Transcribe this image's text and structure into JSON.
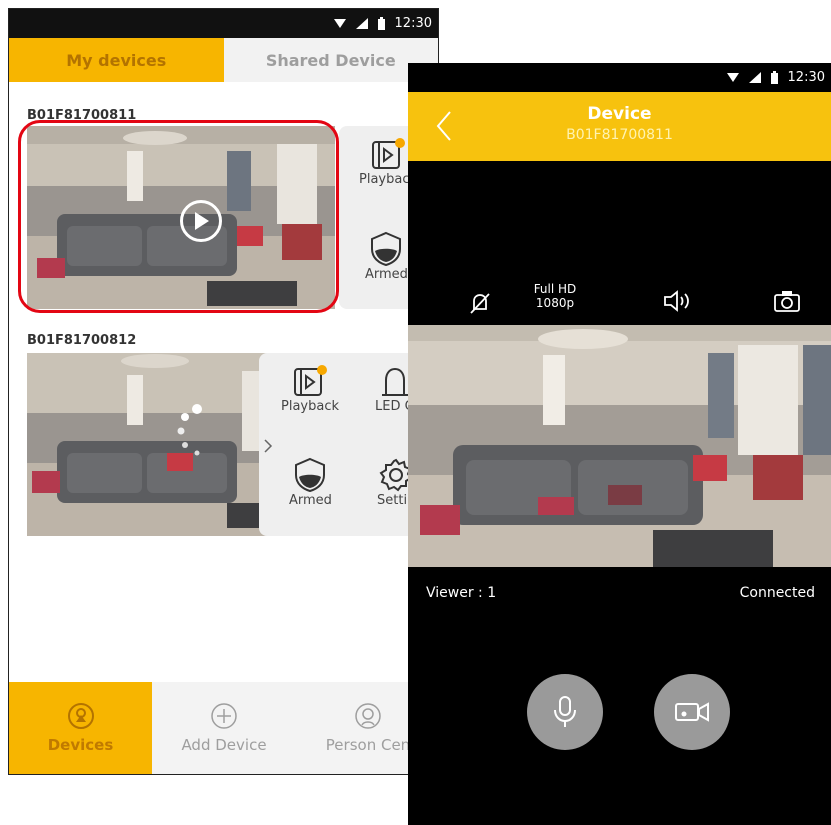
{
  "left_phone": {
    "status_time": "12:30",
    "tabs": {
      "my_devices": "My devices",
      "shared_device": "Shared Device"
    },
    "devices": [
      {
        "id": "B01F81700811",
        "actions": [
          "Playback",
          "Armed"
        ]
      },
      {
        "id": "B01F81700812",
        "actions": [
          "Playback",
          "LED O",
          "Armed",
          "Settin"
        ]
      }
    ],
    "nav": {
      "devices": "Devices",
      "add_device": "Add Device",
      "person_center": "Person Cen"
    }
  },
  "right_phone": {
    "status_time": "12:30",
    "title": "Device",
    "device_id": "B01F81700811",
    "quality": {
      "line1": "Full HD",
      "line2": "1080p"
    },
    "viewer": "Viewer : 1",
    "connection": "Connected"
  },
  "colors": {
    "accent": "#f7b500",
    "highlight": "#e30613",
    "panel": "#efefef"
  },
  "icons": [
    "wifi-icon",
    "signal-icon",
    "battery-icon",
    "play-icon",
    "playback-icon",
    "armed-shield-icon",
    "led-icon",
    "settings-gear-icon",
    "devices-icon",
    "add-icon",
    "person-icon",
    "back-icon",
    "mute-icon",
    "speaker-icon",
    "camera-icon",
    "microphone-icon",
    "video-record-icon"
  ]
}
